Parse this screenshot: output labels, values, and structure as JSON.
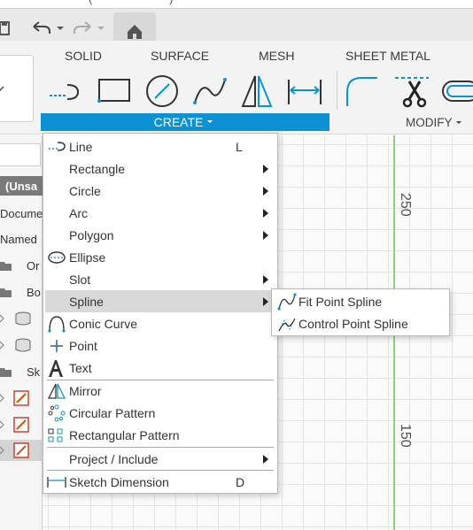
{
  "window": {
    "title_fragment": "(                        )"
  },
  "ribbon": {
    "tabs": [
      "SOLID",
      "SURFACE",
      "MESH",
      "SHEET METAL"
    ],
    "create_label": "CREATE",
    "modify_label": "MODIFY"
  },
  "browser": {
    "rows": [
      "(Unsa",
      "Docume",
      "Named",
      "Or",
      "Bo",
      "Sk"
    ]
  },
  "canvas": {
    "ruler_labels": [
      "250",
      "150"
    ]
  },
  "create_menu": {
    "items": [
      {
        "label": "Line",
        "shortcut": "L",
        "icon": "line-icon"
      },
      {
        "label": "Rectangle",
        "icon": "",
        "submenu": true
      },
      {
        "label": "Circle",
        "icon": "",
        "submenu": true
      },
      {
        "label": "Arc",
        "icon": "",
        "submenu": true
      },
      {
        "label": "Polygon",
        "icon": "",
        "submenu": true
      },
      {
        "label": "Ellipse",
        "icon": "ellipse-icon"
      },
      {
        "label": "Slot",
        "icon": "",
        "submenu": true
      },
      {
        "label": "Spline",
        "icon": "",
        "submenu": true,
        "highlighted": true
      },
      {
        "label": "Conic Curve",
        "icon": "conic-curve-icon"
      },
      {
        "label": "Point",
        "icon": "point-icon"
      },
      {
        "label": "Text",
        "icon": "text-icon"
      },
      {
        "label": "Mirror",
        "icon": "mirror-icon"
      },
      {
        "label": "Circular Pattern",
        "icon": "circular-pattern-icon"
      },
      {
        "label": "Rectangular Pattern",
        "icon": "rectangular-pattern-icon"
      },
      {
        "label": "Project / Include",
        "icon": "",
        "submenu": true
      },
      {
        "label": "Sketch Dimension",
        "shortcut": "D",
        "icon": "sketch-dimension-icon"
      }
    ]
  },
  "spline_submenu": {
    "items": [
      {
        "label": "Fit Point Spline",
        "icon": "fit-point-spline-icon"
      },
      {
        "label": "Control Point Spline",
        "icon": "control-point-spline-icon"
      }
    ]
  },
  "colors": {
    "accent": "#0c91d4",
    "highlight": "#d9d9d9",
    "axis": "#8bd37a"
  }
}
